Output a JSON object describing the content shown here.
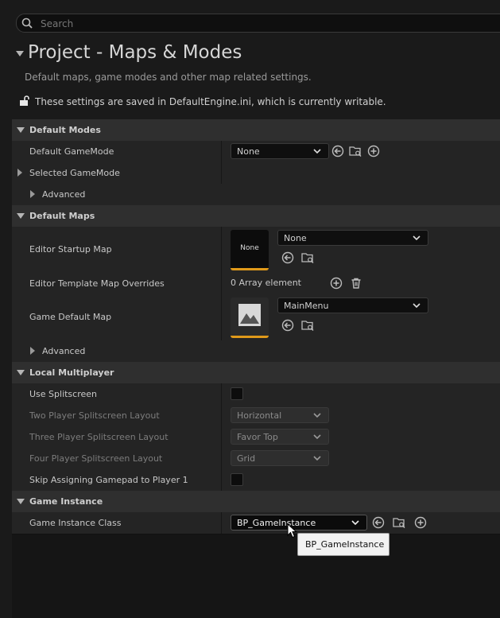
{
  "search": {
    "placeholder": "Search"
  },
  "header": {
    "title": "Project - Maps & Modes",
    "description": "Default maps, game modes and other map related settings.",
    "config_notice": "These settings are saved in DefaultEngine.ini, which is currently writable."
  },
  "sections": {
    "default_modes": {
      "label": "Default Modes",
      "default_gamemode": {
        "label": "Default GameMode",
        "value": "None"
      },
      "selected_gamemode": {
        "label": "Selected GameMode"
      },
      "advanced": {
        "label": "Advanced"
      }
    },
    "default_maps": {
      "label": "Default Maps",
      "editor_startup_map": {
        "label": "Editor Startup Map",
        "thumb_text": "None",
        "value": "None"
      },
      "editor_template_map_overrides": {
        "label": "Editor Template Map Overrides",
        "value": "0 Array element"
      },
      "game_default_map": {
        "label": "Game Default Map",
        "value": "MainMenu"
      },
      "advanced": {
        "label": "Advanced"
      }
    },
    "local_multiplayer": {
      "label": "Local Multiplayer",
      "use_splitscreen": {
        "label": "Use Splitscreen",
        "checked": false
      },
      "two_player_layout": {
        "label": "Two Player Splitscreen Layout",
        "value": "Horizontal"
      },
      "three_player_layout": {
        "label": "Three Player Splitscreen Layout",
        "value": "Favor Top"
      },
      "four_player_layout": {
        "label": "Four Player Splitscreen Layout",
        "value": "Grid"
      },
      "skip_gamepad": {
        "label": "Skip Assigning Gamepad to Player 1",
        "checked": false
      }
    },
    "game_instance": {
      "label": "Game Instance",
      "game_instance_class": {
        "label": "Game Instance Class",
        "value": "BP_GameInstance"
      }
    }
  },
  "tooltip": {
    "text": "BP_GameInstance"
  },
  "colors": {
    "accent_orange": "#e09a1a",
    "background": "#1a1a1a",
    "section_bg": "#2f2f2f",
    "row_bg": "#242424"
  },
  "icons": [
    "search-icon",
    "unlock-icon",
    "use-selected-icon",
    "browse-icon",
    "add-icon",
    "trash-icon",
    "chevron-down-icon",
    "mouse-cursor-icon"
  ]
}
